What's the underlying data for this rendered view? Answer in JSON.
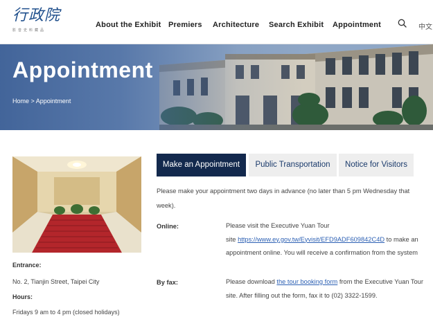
{
  "header": {
    "logo_text": "行政院",
    "logo_subtext": "影音史料藏品",
    "nav": [
      {
        "label": "About the Exhibit"
      },
      {
        "label": "Premiers"
      },
      {
        "label": "Architecture"
      },
      {
        "label": "Search Exhibit"
      },
      {
        "label": "Appointment"
      }
    ],
    "search_icon": "search-icon",
    "lang_label": "中文"
  },
  "banner": {
    "title": "Appointment",
    "breadcrumb": {
      "home": "Home",
      "separator": " > ",
      "current": "Appointment"
    }
  },
  "visit_info": {
    "entrance_label": "Entrance:",
    "entrance_value": "No. 2, Tianjin Street, Taipei City",
    "hours_label": "Hours:",
    "hours_value": "Fridays 9 am to 4 pm (closed holidays)"
  },
  "tabs": [
    {
      "label": "Make an Appointment",
      "active": true
    },
    {
      "label": "Public Transportation",
      "active": false
    },
    {
      "label": "Notice for Visitors",
      "active": false
    }
  ],
  "content": {
    "intro_line1": "Please make your appointment two days in advance (no later than 5 pm Wednesday that",
    "intro_line2": "week).",
    "online": {
      "label": "Online:",
      "line1": "Please visit the Executive Yuan Tour",
      "line2_prefix": "site ",
      "link": "https://www.ey.gov.tw/Eyvisit/EFD9ADF609842C4D",
      "line2_suffix": " to make an",
      "line3": "appointment online. You will receive a confirmation from the system"
    },
    "fax": {
      "label": "By fax:",
      "line1_prefix": "Please download ",
      "link": "the tour booking form",
      "line1_suffix": " from the Executive Yuan Tour",
      "line2": "site. After filling out the form, fax it to (02) 3322-1599."
    }
  },
  "colors": {
    "active_tab": "#13294d",
    "inactive_tab": "#eeeeee",
    "tab_text": "#1a3a6b",
    "link": "#2b5fb3",
    "banner": "#5b79a3"
  }
}
